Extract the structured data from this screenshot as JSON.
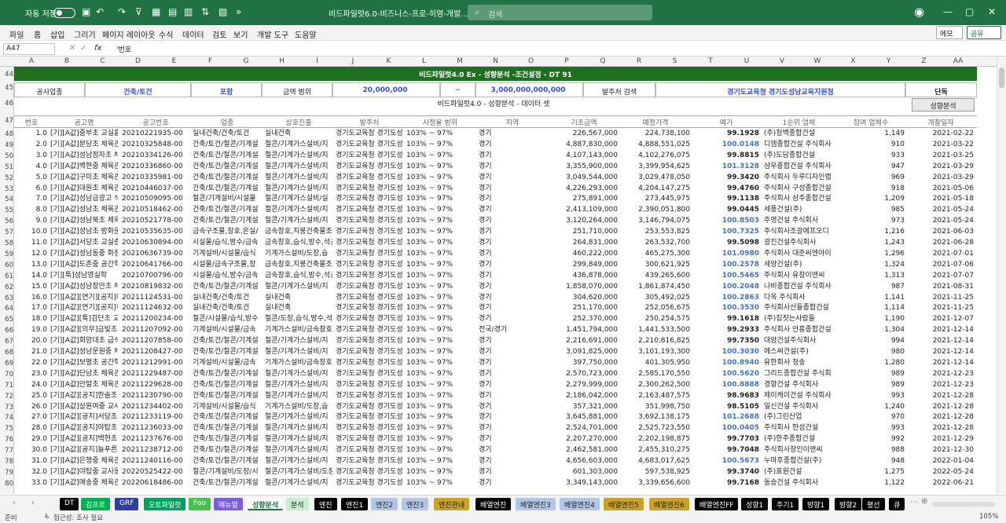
{
  "app": {
    "autosave": "자동 저장",
    "filename": "비드파일럿6.0-비즈니스-프로-히영-개발...",
    "search_placeholder": "검색"
  },
  "menu": [
    "파일",
    "홈",
    "삽입",
    "그리기",
    "페이지 레이아웃",
    "수식",
    "데이터",
    "검토",
    "보기",
    "개발 도구",
    "도움말"
  ],
  "memo": "메모",
  "share": "공유",
  "formula": {
    "namebox": "A47",
    "value": "'번호"
  },
  "columns": [
    "A",
    "B",
    "C",
    "D",
    "E",
    "F",
    "G",
    "H",
    "I",
    "J",
    "K",
    "L",
    "M",
    "N",
    "O",
    "P",
    "Q",
    "R",
    "S",
    "T",
    "U",
    "V",
    "W",
    "X",
    "Y",
    "Z",
    "AA"
  ],
  "row_numbers": [
    "44",
    "45",
    "46",
    "47",
    "48",
    "49",
    "50",
    "51",
    "52",
    "53",
    "54",
    "55",
    "56",
    "57",
    "58",
    "59",
    "60",
    "61",
    "62",
    "63",
    "64",
    "65",
    "66",
    "67",
    "68",
    "69",
    "70",
    "71",
    "72",
    "73",
    "74",
    "75",
    "76",
    "77",
    "78",
    "79",
    "80"
  ],
  "banner": "비드파일럿4.0 Ex - 성향분석 -조건설정 - DT 91",
  "params": {
    "industry_label": "공사업종",
    "industry": "건축/토건",
    "include": "포함",
    "amount_label": "금액 범위",
    "amount_min": "20,000,000",
    "tilde": "~",
    "amount_max": "3,000,000,000,000",
    "client_label": "발주처 검색",
    "client": "경기도교육청 경기도성남교육지원청",
    "mode": "단독"
  },
  "dataset_title": "비드파일럿4.0 - 성향분석 - 데이터 셋",
  "analyze_button": "성향분석",
  "headers": [
    "번호",
    "공고명",
    "공고번호",
    "업종",
    "상호진출",
    "발주처",
    "사정율 범위",
    "지역",
    "기초금액",
    "예정가격",
    "예가",
    "1순위 업체",
    "참여 업체수",
    "개찰일자"
  ],
  "rows": [
    [
      "1.0",
      "[기][A값]중부초 교실흡",
      "20210221935-00",
      "실내건축/건축/토건",
      "실내건축",
      "경기도교육청 경기도성",
      "103% ~ 97%",
      "경기",
      "226,567,000",
      "224,738,100",
      "99.1928",
      "(주)청백종합건설",
      "1,149",
      "2021-02-22"
    ],
    [
      "2.0",
      "[기][A값]분당초 체육관",
      "20210325848-00",
      "건축/토건/철콘/기계설",
      "철콘/기계가스설비/지",
      "경기도교육청 경기도성",
      "103% ~ 97%",
      "경기",
      "4,887,830,000",
      "4,888,551,025",
      "100.0148",
      "디엠종합건설 주식회사",
      "910",
      "2021-03-22"
    ],
    [
      "3.0",
      "[기][A값]성남정자초 체",
      "20210334126-00",
      "건축/토건/철콘/기계설",
      "철콘/기계가스설비/지",
      "경기도교육청 경기도성",
      "103% ~ 97%",
      "경기",
      "4,107,143,000",
      "4,102,276,075",
      "99.8815",
      "(주)도담종합건설",
      "933",
      "2021-03-25"
    ],
    [
      "4.0",
      "[기][A값]백현중 체육관",
      "20210336860-00",
      "건축/토건/철콘/기계설",
      "철콘/기계가스설비/지",
      "경기도교육청 경기도성",
      "103% ~ 97%",
      "경기",
      "3,355,900,000",
      "3,399,954,625",
      "101.3128",
      "삼우종합건설 주식회사",
      "947",
      "2021-03-29"
    ],
    [
      "5.0",
      "[기][A값]구미초 체육관",
      "20210335981-00",
      "건축/토건/철콘/기계설",
      "철콘/기계가스설비/지",
      "경기도교육청 경기도성",
      "103% ~ 97%",
      "경기",
      "3,049,544,000",
      "3,029,478,050",
      "99.3420",
      "주식회사 두루디자인랩",
      "969",
      "2021-03-29"
    ],
    [
      "6.0",
      "[기][A값]대원초 체육관",
      "20210446037-00",
      "건축/토건/철콘/기계설",
      "철콘/기계가스설비/지",
      "경기도교육청 경기도성",
      "103% ~ 97%",
      "경기",
      "4,226,293,000",
      "4,204,147,275",
      "99.4760",
      "주식회사 구성종합건설",
      "918",
      "2021-05-06"
    ],
    [
      "7.0",
      "[기][A값]성남금광고 식",
      "20210509095-00",
      "철콘/기계설비/시설물",
      "철콘/기계가스설비/실",
      "경기도교육청 경기도성",
      "103% ~ 97%",
      "경기",
      "275,891,000",
      "273,445,975",
      "99.1138",
      "주식회사 삼주종합건설",
      "1,209",
      "2021-05-18"
    ],
    [
      "8.0",
      "[기][A값]성남초 체육관",
      "20210518462-00",
      "건축/토건/철콘/기계설",
      "철콘/기계가스설비/지",
      "경기도교육청 경기도성",
      "103% ~ 97%",
      "경기",
      "2,413,109,000",
      "2,390,051,800",
      "99.0445",
      "세풍건설(주)",
      "985",
      "2021-05-24"
    ],
    [
      "9.0",
      "[기][A값]성남북초 체육",
      "20210521778-00",
      "건축/토건/철콘/기계설",
      "철콘/기계가스설비/지",
      "경기도교육청 경기도성",
      "103% ~ 97%",
      "경기",
      "3,120,264,000",
      "3,146,794,075",
      "100.8503",
      "주영건설 주식회사",
      "973",
      "2021-05-24"
    ],
    [
      "10.0",
      "[기][A값]성남초 방화문",
      "20210535635-00",
      "금속구조물,창호,온실/",
      "금속창호,지붕건축물조",
      "경기도교육청 경기도성",
      "103% ~ 97%",
      "경기",
      "251,710,000",
      "253,553,825",
      "100.7325",
      "주식회사조광에프오디",
      "1,216",
      "2021-06-03"
    ],
    [
      "11.0",
      "[기][A값]서당초 교실증",
      "20210630894-00",
      "시설물/습식,방수/금속",
      "금속창호,습식,방수,석공",
      "경기도교육청 경기도성",
      "103% ~ 97%",
      "경기",
      "264,831,000",
      "263,532,700",
      "99.5098",
      "광진건설주식회사",
      "1,243",
      "2021-06-28"
    ],
    [
      "12.0",
      "[기][A값]성남동중 화장",
      "20210636739-00",
      "기계설비/시설물/습식",
      "기계가스설비/도장,습",
      "경기도교육청 경기도성",
      "103% ~ 97%",
      "경기",
      "460,222,000",
      "465,275,300",
      "101.0980",
      "주식회사 대준씨엔아이",
      "1,296",
      "2021-07-01"
    ],
    [
      "13.0",
      "[기][A값]도촌중 공간혁",
      "20210641766-00",
      "시설물/금속구조물,창",
      "금속창호,지붕건축물조",
      "경기도교육청 경기도성",
      "103% ~ 97%",
      "경기",
      "299,849,000",
      "300,621,925",
      "100.2578",
      "세양건설(주)",
      "1,324",
      "2021-07-06"
    ],
    [
      "14.0",
      "[기][특]성남영실학",
      "20210700796-00",
      "시설물/습식,방수/금속",
      "금속창호,습식,방수,석공",
      "경기도교육청 경기도성",
      "103% ~ 97%",
      "경기",
      "436,878,000",
      "439,265,600",
      "100.5465",
      "주식회사 유창이앤씨",
      "1,313",
      "2021-07-07"
    ],
    [
      "15.0",
      "[기][A값]성남창안초 체",
      "20210819832-00",
      "건축/토건/철콘/기계설",
      "철콘/기계가스설비/지",
      "경기도교육청 경기도성",
      "103% ~ 97%",
      "경기",
      "1,858,070,000",
      "1,861,874,450",
      "100.2048",
      "나비종합건설 주식회사",
      "987",
      "2021-08-31"
    ],
    [
      "16.0",
      "[기][A값][연기][공지]대",
      "20211124531-00",
      "실내건축/건축/토건",
      "실내건축",
      "경기도교육청 경기도성",
      "103% ~ 97%",
      "경기",
      "304,620,000",
      "305,492,025",
      "100.2863",
      "다옥 주식회사",
      "1,141",
      "2021-11-25"
    ],
    [
      "17.0",
      "[기][A값][연기][공지]하",
      "20211124632-00",
      "실내건축/건축/토건",
      "실내건축",
      "경기도교육청 경기도성",
      "103% ~ 97%",
      "경기",
      "251,170,000",
      "252,056,675",
      "100.3530",
      "주식회사산들종합건설",
      "1,114",
      "2021-11-25"
    ],
    [
      "18.0",
      "[기][A값][특]검단초 교",
      "20211200234-00",
      "철콘/시설물/습식,방수",
      "철콘/도장,습식,방수,석",
      "경기도교육청 경기도성",
      "103% ~ 97%",
      "경기",
      "252,370,000",
      "250,254,575",
      "99.1618",
      "(주)집짓는사람들",
      "1,190",
      "2021-12-07"
    ],
    [
      "19.0",
      "[기][A값][의무]금빛초",
      "20211207092-00",
      "기계설비/시설물/금속",
      "기계가스설비/금속창호",
      "경기도교육청 경기도성",
      "103% ~ 97%",
      "전국/경기",
      "1,451,794,000",
      "1,441,533,500",
      "99.2933",
      "주식회사 안흥종합건설",
      "1,304",
      "2021-12-14"
    ],
    [
      "20.0",
      "[기][A값]회망대초 급식",
      "20211207858-00",
      "건축/토건/철콘/기계설",
      "철콘/기계가스설비/지",
      "경기도교육청 경기도성",
      "103% ~ 97%",
      "경기",
      "2,216,691,000",
      "2,210,816,825",
      "99.7350",
      "대양건설주식회사",
      "994",
      "2021-12-14"
    ],
    [
      "21.0",
      "[기][A값]성남문원중 체",
      "20211208427-00",
      "건축/토건/철콘/기계설",
      "철콘/기계가스설비/지",
      "경기도교육청 경기도성",
      "103% ~ 97%",
      "경기",
      "3,091,825,000",
      "3,101,193,300",
      "100.3030",
      "에스써건설(주)",
      "980",
      "2021-12-14"
    ],
    [
      "22.0",
      "[기][A값]보평초 공간혁",
      "20211212991-00",
      "기계설비/시설물/금속",
      "기계가스설비/금속창호",
      "경기도교육청 경기도성",
      "103% ~ 97%",
      "경기",
      "397,750,000",
      "401,305,950",
      "100.8940",
      "유한회사 청송",
      "1,280",
      "2021-12-14"
    ],
    [
      "23.0",
      "[기][A값]단남초 체육관",
      "20211229487-00",
      "건축/토건/철콘/기계설",
      "철콘/기계가스설비/지",
      "경기도교육청 경기도성",
      "103% ~ 97%",
      "경기",
      "2,570,723,000",
      "2,585,170,550",
      "100.5620",
      "그리드종합건설 주식회",
      "989",
      "2021-12-23"
    ],
    [
      "24.0",
      "[기][A값]안말초 체육관",
      "20211229628-00",
      "건축/토건/철콘/기계설",
      "철콘/기계가스설비/지",
      "경기도교육청 경기도성",
      "103% ~ 97%",
      "경기",
      "2,279,999,000",
      "2,300,262,500",
      "100.8888",
      "경향건설 주식회사",
      "989",
      "2021-12-23"
    ],
    [
      "25.0",
      "[기][A값][공지]한솔초",
      "20211230790-00",
      "건축/토건/철콘/기계설",
      "철콘/기계가스설비/지",
      "경기도교육청 경기도성",
      "103% ~ 97%",
      "경기",
      "2,186,042,000",
      "2,163,487,575",
      "98.9683",
      "제이케이건설 주식회사",
      "993",
      "2021-12-28"
    ],
    [
      "26.0",
      "[기][A값]상원여중 교사",
      "20211234402-00",
      "기계설비/시설물/습식",
      "기계가스설비/도장,습",
      "경기도교육청 경기도성",
      "103% ~ 97%",
      "경기",
      "357,321,000",
      "351,998,750",
      "98.5105",
      "일신건설 주식회사",
      "1,240",
      "2021-12-28"
    ],
    [
      "27.0",
      "[기][A값][공지]서당초",
      "20211233119-00",
      "건축/토건/철콘/기계설",
      "철콘/기계가스설비/지",
      "경기도교육청 경기도성",
      "103% ~ 97%",
      "경기",
      "3,645,881,000",
      "3,692,138,175",
      "101.2688",
      "(주)그린산업",
      "970",
      "2021-12-28"
    ],
    [
      "28.0",
      "[기][A값][공지]야탑초",
      "20211236033-00",
      "건축/토건/철콘/기계설",
      "철콘/기계가스설비/지",
      "경기도교육청 경기도성",
      "103% ~ 97%",
      "경기",
      "2,524,701,000",
      "2,525,723,550",
      "100.0405",
      "주식회사 한성건설",
      "993",
      "2021-12-28"
    ],
    [
      "29.0",
      "[기][A값][공지]백현초",
      "20211237676-00",
      "건축/토건/철콘/기계설",
      "철콘/기계가스설비/지",
      "경기도교육청 경기도성",
      "103% ~ 97%",
      "경기",
      "2,207,270,000",
      "2,202,198,875",
      "99.7703",
      "(주)한주종합건설",
      "992",
      "2021-12-29"
    ],
    [
      "30.0",
      "[기][A값][공지]늘푸른초",
      "20211238712-00",
      "건축/토건/철콘/기계설",
      "철콘/기계가스설비/지",
      "경기도교육청 경기도성",
      "103% ~ 97%",
      "경기",
      "2,462,581,000",
      "2,455,310,275",
      "99.7048",
      "주식회사장인이앤씨",
      "988",
      "2021-12-30"
    ],
    [
      "31.0",
      "[기][A값]은행중 체육관",
      "20211240116-00",
      "건축/토건/철콘/기계설",
      "철콘/기계가스설비/지",
      "경기도교육청 경기도성",
      "103% ~ 97%",
      "경기",
      "4,656,603,000",
      "4,683,017,625",
      "100.5673",
      "누마후종합건설(주)",
      "948",
      "2022-01-04"
    ],
    [
      "32.0",
      "[기][A값]야탑중 교사동",
      "20220525422-00",
      "철콘/기계설비/도장/시",
      "철콘/기계가스설비/도장",
      "경기도교육청 경기도성",
      "103% ~ 97%",
      "경기",
      "601,303,000",
      "597,538,925",
      "99.3740",
      "(주)표원건설",
      "1,275",
      "2022-05-24"
    ],
    [
      "33.0",
      "[기][A값]매송중 체육관",
      "20220618486-00",
      "건축/토건/철콘/기계설",
      "철콘/기계가스설비/지",
      "경기도교육청 경기도성",
      "103% ~ 97%",
      "경기",
      "3,349,143,000",
      "3,339,656,600",
      "99.7168",
      "동승건설 주식회사",
      "1,122",
      "2022-06-21"
    ]
  ],
  "sheet_tabs": [
    {
      "label": "DT",
      "bg": "#000000",
      "fg": "#ffffff"
    },
    {
      "label": "김프로",
      "bg": "#00b050",
      "fg": "#ffffff"
    },
    {
      "label": "GRF",
      "bg": "#2f3f9f",
      "fg": "#ffffff"
    },
    {
      "label": "오토파일럿",
      "bg": "#00a060",
      "fg": "#ffffff"
    },
    {
      "label": "Foo",
      "bg": "#4cc04c",
      "fg": "#ffffff"
    },
    {
      "label": "매뉴얼",
      "bg": "#7b5fd6",
      "fg": "#ffffff"
    },
    {
      "label": "성향분석",
      "bg": "#ffffff",
      "fg": "#207245"
    },
    {
      "label": "분석",
      "bg": "#c6efce",
      "fg": "#222222"
    },
    {
      "label": "엔진",
      "bg": "#000000",
      "fg": "#ffffff"
    },
    {
      "label": "엔진1",
      "bg": "#000000",
      "fg": "#ffffff"
    },
    {
      "label": "엔진2",
      "bg": "#b4c6e7",
      "fg": "#222222"
    },
    {
      "label": "엔진3",
      "bg": "#b4c6e7",
      "fg": "#222222"
    },
    {
      "label": "엔진관내",
      "bg": "#c9a227",
      "fg": "#222222"
    },
    {
      "label": "배열엔진",
      "bg": "#000000",
      "fg": "#ffffff"
    },
    {
      "label": "배열엔진3",
      "bg": "#b4c6e7",
      "fg": "#222222"
    },
    {
      "label": "배열엔진4",
      "bg": "#b4c6e7",
      "fg": "#222222"
    },
    {
      "label": "배열엔진5",
      "bg": "#c9a227",
      "fg": "#222222"
    },
    {
      "label": "배열엔진6",
      "bg": "#c9a227",
      "fg": "#222222"
    },
    {
      "label": "배열엔진FF",
      "bg": "#000000",
      "fg": "#ffffff"
    },
    {
      "label": "성향1",
      "bg": "#000000",
      "fg": "#ffffff"
    },
    {
      "label": "주기1",
      "bg": "#000000",
      "fg": "#ffffff"
    },
    {
      "label": "방향1",
      "bg": "#000000",
      "fg": "#ffffff"
    },
    {
      "label": "방향2",
      "bg": "#000000",
      "fg": "#ffffff"
    },
    {
      "label": "평선",
      "bg": "#000000",
      "fg": "#ffffff"
    },
    {
      "label": "큐",
      "bg": "#000000",
      "fg": "#ffffff"
    }
  ],
  "status": {
    "mode": "준비",
    "accessibility": "접근성: 조사 필요",
    "zoom": "105%"
  }
}
